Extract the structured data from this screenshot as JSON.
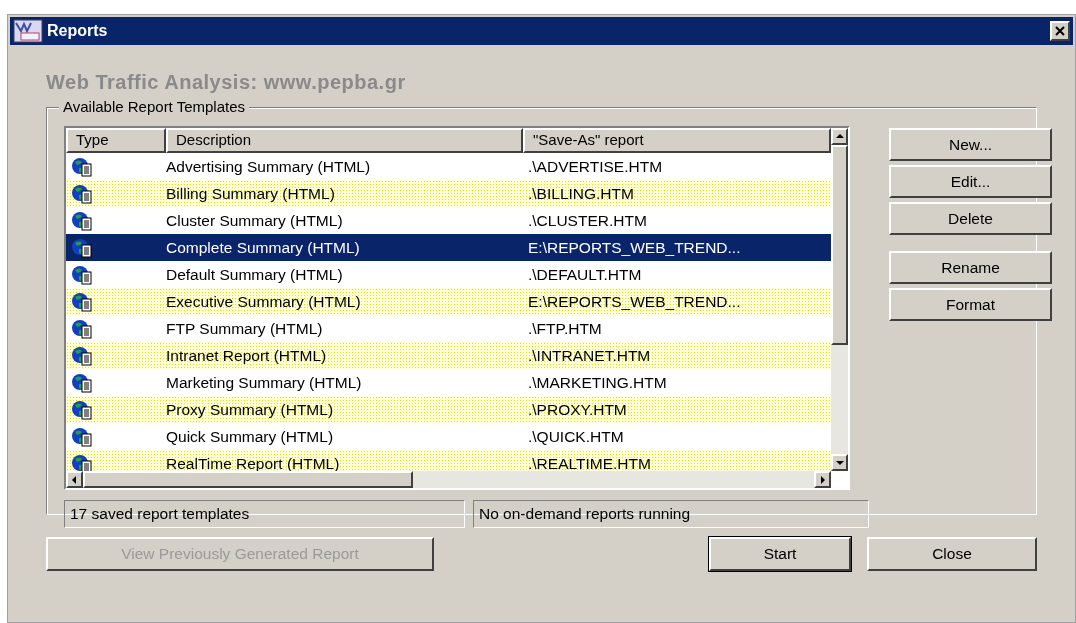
{
  "window": {
    "title": "Reports"
  },
  "heading": "Web Traffic Analysis: www.pepba.gr",
  "group_title": "Available Report Templates",
  "table": {
    "columns": [
      "Type",
      "Description",
      "\"Save-As\" report"
    ],
    "rows": [
      {
        "description": "Advertising Summary (HTML)",
        "save_as": ".\\ADVERTISE.HTM",
        "shaded": false,
        "selected": false
      },
      {
        "description": "Billing Summary (HTML)",
        "save_as": ".\\BILLING.HTM",
        "shaded": true,
        "selected": false
      },
      {
        "description": "Cluster Summary (HTML)",
        "save_as": ".\\CLUSTER.HTM",
        "shaded": false,
        "selected": false
      },
      {
        "description": "Complete Summary (HTML)",
        "save_as": "E:\\REPORTS_WEB_TREND...",
        "selected": true
      },
      {
        "description": "Default Summary (HTML)",
        "save_as": ".\\DEFAULT.HTM",
        "shaded": false,
        "selected": false
      },
      {
        "description": "Executive Summary (HTML)",
        "save_as": "E:\\REPORTS_WEB_TREND...",
        "shaded": true,
        "selected": false
      },
      {
        "description": "FTP Summary (HTML)",
        "save_as": ".\\FTP.HTM",
        "shaded": false,
        "selected": false
      },
      {
        "description": "Intranet Report (HTML)",
        "save_as": ".\\INTRANET.HTM",
        "shaded": true,
        "selected": false
      },
      {
        "description": "Marketing Summary (HTML)",
        "save_as": ".\\MARKETING.HTM",
        "shaded": false,
        "selected": false
      },
      {
        "description": "Proxy Summary (HTML)",
        "save_as": ".\\PROXY.HTM",
        "shaded": true,
        "selected": false
      },
      {
        "description": "Quick Summary (HTML)",
        "save_as": ".\\QUICK.HTM",
        "shaded": false,
        "selected": false
      },
      {
        "description": "RealTime Report (HTML)",
        "save_as": ".\\REALTIME.HTM",
        "shaded": true,
        "selected": false
      }
    ]
  },
  "side_button_groups": [
    [
      "New...",
      "Edit...",
      "Delete"
    ],
    [
      "Rename",
      "Format"
    ]
  ],
  "status": [
    "17 saved report templates",
    "No on-demand reports running"
  ],
  "bottom_buttons": [
    {
      "label": "View Previously Generated Report",
      "disabled": true,
      "default": false
    },
    {
      "label": "Start",
      "disabled": false,
      "default": true
    },
    {
      "label": "Close",
      "disabled": false,
      "default": false
    }
  ]
}
